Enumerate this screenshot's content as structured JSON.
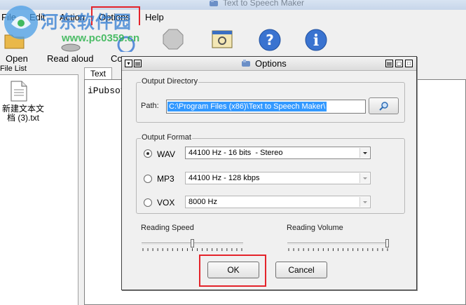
{
  "window": {
    "title": "Text to Speech Maker"
  },
  "watermark": {
    "site_name": "河东软件园",
    "url": "www.pc0359.cn"
  },
  "menu": {
    "items": [
      {
        "label": "File"
      },
      {
        "label": "Edit"
      },
      {
        "label": "Action"
      },
      {
        "label": "Options"
      },
      {
        "label": "Help"
      }
    ]
  },
  "toolbar": {
    "open_label": "Open",
    "read_aloud_label": "Read aloud",
    "convert_label": "Co"
  },
  "file_list": {
    "header": "File List",
    "files": [
      {
        "name": "新建文本文档 (3).txt"
      }
    ]
  },
  "editor": {
    "tab_label": "Text",
    "content": "iPubsoft"
  },
  "dialog": {
    "title": "Options",
    "output_directory": {
      "group_label": "Output Directory",
      "path_label": "Path:",
      "path_value": "C:\\Program Files (x86)\\Text to Speech Maker\\"
    },
    "output_format": {
      "group_label": "Output Format",
      "formats": [
        {
          "label": "WAV",
          "value": "44100 Hz - 16 bits  - Stereo",
          "selected": true
        },
        {
          "label": "MP3",
          "value": "44100 Hz - 128 kbps",
          "selected": false
        },
        {
          "label": "VOX",
          "value": "8000 Hz",
          "selected": false
        }
      ]
    },
    "reading_speed_label": "Reading Speed",
    "reading_volume_label": "Reading Volume",
    "reading_speed_level": 0.5,
    "reading_volume_level": 1.0,
    "ok_label": "OK",
    "cancel_label": "Cancel"
  },
  "colors": {
    "highlight_red": "#e4232a",
    "selection_blue": "#3399ff"
  }
}
